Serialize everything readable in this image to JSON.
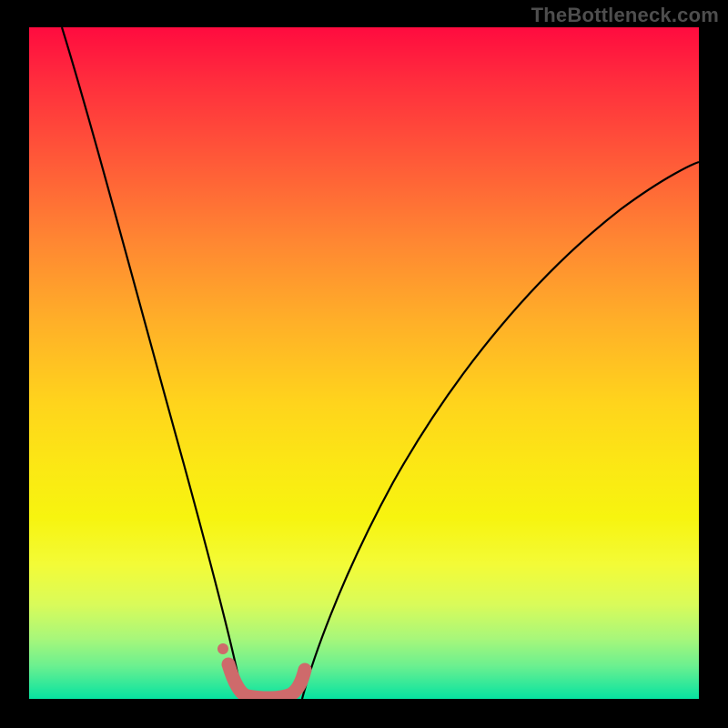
{
  "watermark": "TheBottleneck.com",
  "chart_data": {
    "type": "line",
    "title": "",
    "xlabel": "",
    "ylabel": "",
    "x_range": [
      0,
      100
    ],
    "y_range": [
      0,
      100
    ],
    "grid": false,
    "legend": false,
    "background_gradient": {
      "orientation": "vertical",
      "stops": [
        {
          "pos": 0.0,
          "color": "#ff0b3f"
        },
        {
          "pos": 0.5,
          "color": "#ffd41c"
        },
        {
          "pos": 0.8,
          "color": "#f3fb37"
        },
        {
          "pos": 1.0,
          "color": "#06e3a0"
        }
      ]
    },
    "series": [
      {
        "name": "left-arm-curve",
        "color": "#000000",
        "stroke_width": 2,
        "x": [
          5,
          8,
          12,
          16,
          20,
          24,
          27,
          29,
          30.5,
          31.5
        ],
        "y": [
          100,
          85,
          67,
          50,
          35,
          22,
          12,
          6,
          2,
          0
        ]
      },
      {
        "name": "right-arm-curve",
        "color": "#000000",
        "stroke_width": 2,
        "x": [
          40,
          42,
          46,
          52,
          60,
          70,
          82,
          100
        ],
        "y": [
          0,
          4,
          12,
          24,
          38,
          52,
          64,
          78
        ]
      },
      {
        "name": "valley-highlight",
        "color": "#CE6A6B",
        "stroke_width": 11,
        "stroke_linecap": "round",
        "x": [
          29,
          30.5,
          31.5,
          33,
          35,
          37,
          39,
          40.5
        ],
        "y": [
          5,
          1,
          0,
          0,
          0,
          0,
          1.5,
          5
        ]
      },
      {
        "name": "highlight-dot",
        "type": "scatter",
        "color": "#CE6A6B",
        "marker_radius": 5,
        "x": [
          28.2
        ],
        "y": [
          8
        ]
      }
    ]
  }
}
